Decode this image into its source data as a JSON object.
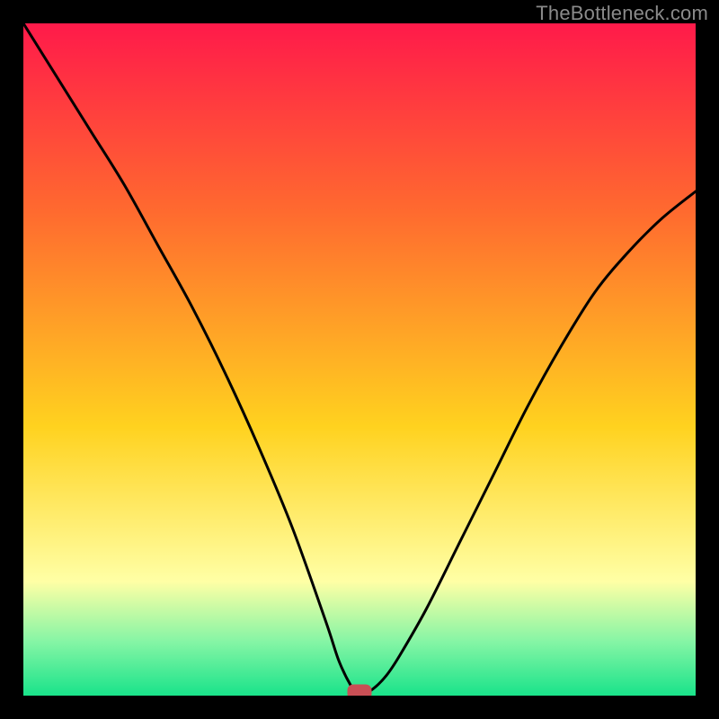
{
  "watermark_text": "TheBottleneck.com",
  "colors": {
    "background_black": "#000000",
    "gradient_top": "#ff1a4a",
    "gradient_mid_upper": "#ff6a2f",
    "gradient_mid": "#ffd21f",
    "gradient_band": "#ffffa5",
    "gradient_green_light": "#85f5a5",
    "gradient_green": "#19e38a",
    "curve_stroke": "#000000",
    "marker_fill": "#c94f55"
  },
  "chart_data": {
    "type": "line",
    "title": "",
    "xlabel": "",
    "ylabel": "",
    "xlim": [
      0,
      100
    ],
    "ylim": [
      0,
      100
    ],
    "annotations": [],
    "series": [
      {
        "name": "bottleneck-curve",
        "x": [
          0,
          5,
          10,
          15,
          20,
          25,
          30,
          35,
          40,
          45,
          47,
          49,
          50,
          52,
          54,
          56,
          60,
          65,
          70,
          75,
          80,
          85,
          90,
          95,
          100
        ],
        "values": [
          100,
          92,
          84,
          76,
          67,
          58,
          48,
          37,
          25,
          11,
          5,
          1,
          0,
          1,
          3,
          6,
          13,
          23,
          33,
          43,
          52,
          60,
          66,
          71,
          75
        ]
      }
    ],
    "marker": {
      "x": 50,
      "y": 0,
      "shape": "rounded-rect"
    }
  }
}
